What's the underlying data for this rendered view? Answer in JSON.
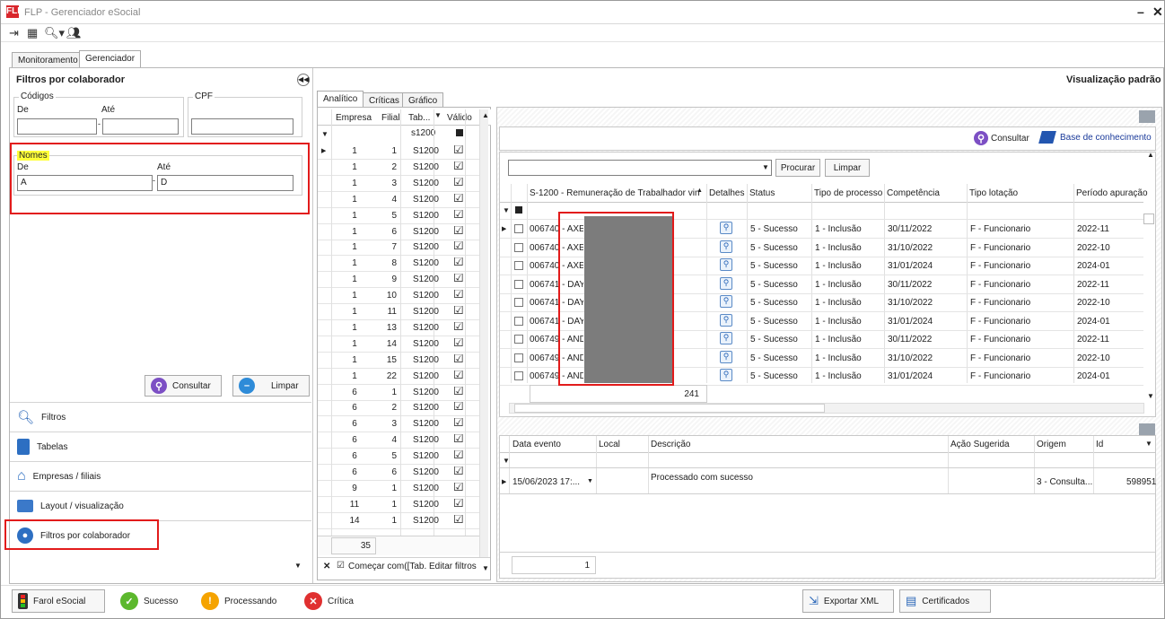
{
  "window": {
    "title": "FLP - Gerenciador eSocial",
    "app_icon": "FLP"
  },
  "tabs_top": [
    "Monitoramento",
    "Gerenciador"
  ],
  "left": {
    "title": "Filtros por colaborador",
    "codigos": {
      "label": "Códigos",
      "de": "De",
      "ate": "Até",
      "de_value": "",
      "ate_value": ""
    },
    "cpf": {
      "label": "CPF",
      "value": ""
    },
    "nomes": {
      "label": "Nomes",
      "de": "De",
      "ate": "Até",
      "de_value": "A",
      "ate_value": "D"
    },
    "consultar": "Consultar",
    "limpar": "Limpar",
    "nav": [
      "Filtros",
      "Tabelas",
      "Empresas / filiais",
      "Layout / visualização",
      "Filtros por colaborador"
    ]
  },
  "right_title": "Visualização padrão",
  "sub_tabs": [
    "Analítico",
    "Críticas",
    "Gráfico"
  ],
  "grid1": {
    "headers": [
      "Empresa",
      "Filial",
      "Tab...",
      "Válido"
    ],
    "filter_value": "s1200",
    "rows": [
      [
        "1",
        "1",
        "S1200"
      ],
      [
        "1",
        "2",
        "S1200"
      ],
      [
        "1",
        "3",
        "S1200"
      ],
      [
        "1",
        "4",
        "S1200"
      ],
      [
        "1",
        "5",
        "S1200"
      ],
      [
        "1",
        "6",
        "S1200"
      ],
      [
        "1",
        "7",
        "S1200"
      ],
      [
        "1",
        "8",
        "S1200"
      ],
      [
        "1",
        "9",
        "S1200"
      ],
      [
        "1",
        "10",
        "S1200"
      ],
      [
        "1",
        "11",
        "S1200"
      ],
      [
        "1",
        "13",
        "S1200"
      ],
      [
        "1",
        "14",
        "S1200"
      ],
      [
        "1",
        "15",
        "S1200"
      ],
      [
        "1",
        "22",
        "S1200"
      ],
      [
        "6",
        "1",
        "S1200"
      ],
      [
        "6",
        "2",
        "S1200"
      ],
      [
        "6",
        "3",
        "S1200"
      ],
      [
        "6",
        "4",
        "S1200"
      ],
      [
        "6",
        "5",
        "S1200"
      ],
      [
        "6",
        "6",
        "S1200"
      ],
      [
        "9",
        "1",
        "S1200"
      ],
      [
        "11",
        "1",
        "S1200"
      ],
      [
        "14",
        "1",
        "S1200"
      ]
    ],
    "total": "35",
    "footer_filter": "Começar com([Tab...",
    "edit_filters": "Editar filtros"
  },
  "grid2": {
    "consultar": "Consultar",
    "base": "Base de conhecimento",
    "procurar": "Procurar",
    "limpar": "Limpar",
    "headers": [
      "S-1200 - Remuneração de Trabalhador vin...",
      "Detalhes",
      "Status",
      "Tipo de processo",
      "Competência",
      "Tipo lotação",
      "Período apuração"
    ],
    "rows": [
      [
        "006740 - AXEL",
        "5 - Sucesso",
        "1 - Inclusão",
        "30/11/2022",
        "F - Funcionario",
        "2022-11"
      ],
      [
        "006740 - AXEL",
        "5 - Sucesso",
        "1 - Inclusão",
        "31/10/2022",
        "F - Funcionario",
        "2022-10"
      ],
      [
        "006740 - AXEL",
        "5 - Sucesso",
        "1 - Inclusão",
        "31/01/2024",
        "F - Funcionario",
        "2024-01"
      ],
      [
        "006741 - DAYE",
        "5 - Sucesso",
        "1 - Inclusão",
        "30/11/2022",
        "F - Funcionario",
        "2022-11"
      ],
      [
        "006741 - DAYE",
        "5 - Sucesso",
        "1 - Inclusão",
        "31/10/2022",
        "F - Funcionario",
        "2022-10"
      ],
      [
        "006741 - DAYE",
        "5 - Sucesso",
        "1 - Inclusão",
        "31/01/2024",
        "F - Funcionario",
        "2024-01"
      ],
      [
        "006749 - ANDR",
        "5 - Sucesso",
        "1 - Inclusão",
        "30/11/2022",
        "F - Funcionario",
        "2022-11"
      ],
      [
        "006749 - ANDR",
        "5 - Sucesso",
        "1 - Inclusão",
        "31/10/2022",
        "F - Funcionario",
        "2022-10"
      ],
      [
        "006749 - ANDR",
        "5 - Sucesso",
        "1 - Inclusão",
        "31/01/2024",
        "F - Funcionario",
        "2024-01"
      ]
    ],
    "total": "241"
  },
  "grid3": {
    "headers": [
      "Data evento",
      "Local",
      "Descrição",
      "Ação Sugerida",
      "Origem",
      "Id"
    ],
    "row": [
      "15/06/2023 17:...",
      "",
      "Processado com sucesso",
      "",
      "3 - Consulta...",
      "598951"
    ],
    "total": "1"
  },
  "status": {
    "farol": "Farol eSocial",
    "sucesso": "Sucesso",
    "processando": "Processando",
    "critica": "Crítica",
    "exportar": "Exportar XML",
    "certificados": "Certificados"
  }
}
